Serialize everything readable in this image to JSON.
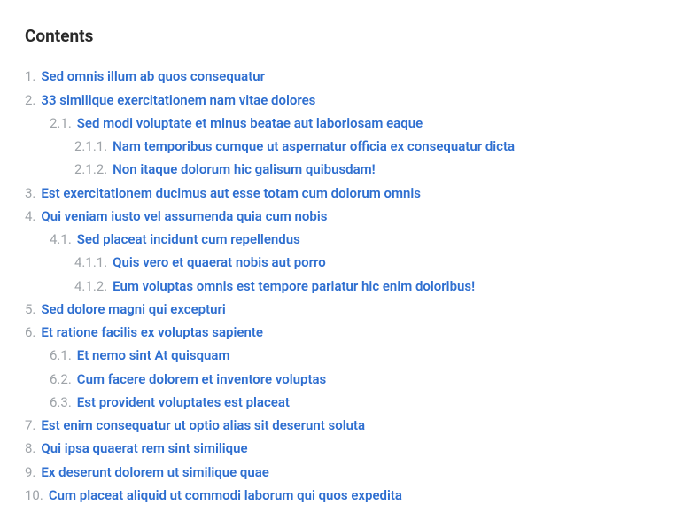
{
  "title": "Contents",
  "items": [
    {
      "num": "1.",
      "label": "Sed omnis illum ab quos consequatur",
      "level": 1
    },
    {
      "num": "2.",
      "label": "33 similique exercitationem nam vitae dolores",
      "level": 1
    },
    {
      "num": "2.1.",
      "label": "Sed modi voluptate et minus beatae aut laboriosam eaque",
      "level": 2
    },
    {
      "num": "2.1.1.",
      "label": "Nam temporibus cumque ut aspernatur officia ex consequatur dicta",
      "level": 3
    },
    {
      "num": "2.1.2.",
      "label": "Non itaque dolorum hic galisum quibusdam!",
      "level": 3
    },
    {
      "num": "3.",
      "label": "Est exercitationem ducimus aut esse totam cum dolorum omnis",
      "level": 1
    },
    {
      "num": "4.",
      "label": "Qui veniam iusto vel assumenda quia cum nobis",
      "level": 1
    },
    {
      "num": "4.1.",
      "label": "Sed placeat incidunt cum repellendus",
      "level": 2
    },
    {
      "num": "4.1.1.",
      "label": "Quis vero et quaerat nobis aut porro",
      "level": 3
    },
    {
      "num": "4.1.2.",
      "label": "Eum voluptas omnis est tempore pariatur hic enim doloribus!",
      "level": 3
    },
    {
      "num": "5.",
      "label": "Sed dolore magni qui excepturi",
      "level": 1
    },
    {
      "num": "6.",
      "label": "Et ratione facilis ex voluptas sapiente",
      "level": 1
    },
    {
      "num": "6.1.",
      "label": "Et nemo sint At quisquam",
      "level": 2
    },
    {
      "num": "6.2.",
      "label": "Cum facere dolorem et inventore voluptas",
      "level": 2
    },
    {
      "num": "6.3.",
      "label": "Est provident voluptates est placeat",
      "level": 2
    },
    {
      "num": "7.",
      "label": "Est enim consequatur ut optio alias sit deserunt soluta",
      "level": 1
    },
    {
      "num": "8.",
      "label": "Qui ipsa quaerat rem sint similique",
      "level": 1
    },
    {
      "num": "9.",
      "label": "Ex deserunt dolorem ut similique quae",
      "level": 1
    },
    {
      "num": "10.",
      "label": "Cum placeat aliquid ut commodi laborum qui quos expedita",
      "level": 1
    }
  ]
}
